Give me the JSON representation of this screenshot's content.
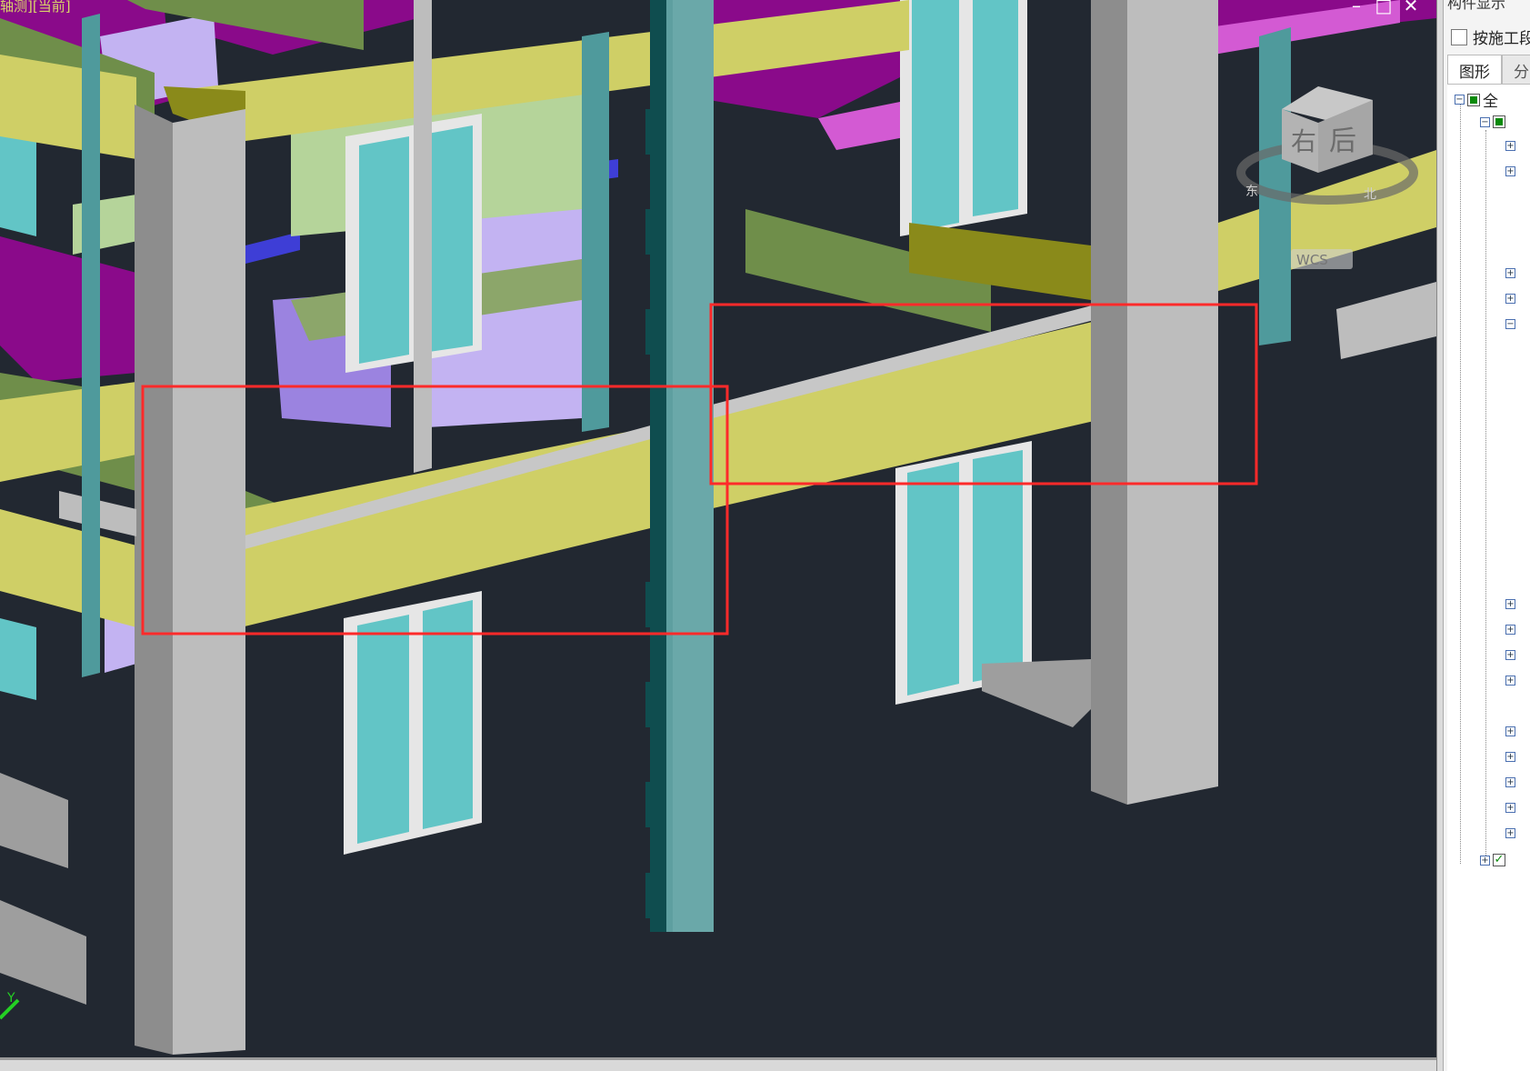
{
  "viewport": {
    "view_label": "轴测][当前]",
    "background": "#222831",
    "nav_cube": {
      "face_right": "右",
      "face_back": "后",
      "wcs_label": "WCS",
      "ring_labels": [
        "东",
        "北"
      ]
    },
    "axis_indicator": {
      "y_label": "Y"
    },
    "window_controls": [
      "–",
      "□",
      "✕"
    ],
    "highlight_color": "#ff2a2a"
  },
  "colors": {
    "beam_yellow": "#cfcf66",
    "column_gray": "#bdbdbd",
    "slab_magenta": "#8a0a8a",
    "window_cyan": "#62c5c6",
    "wall_lilac": "#c3b3f2",
    "beam_green": "#6f8e4a",
    "pipe_teal": "#4f9a9c"
  },
  "side_panel": {
    "title": "构件显示",
    "filter_label": "按施工段",
    "tabs": [
      "图形",
      "分"
    ],
    "tree_root_label": "全"
  }
}
